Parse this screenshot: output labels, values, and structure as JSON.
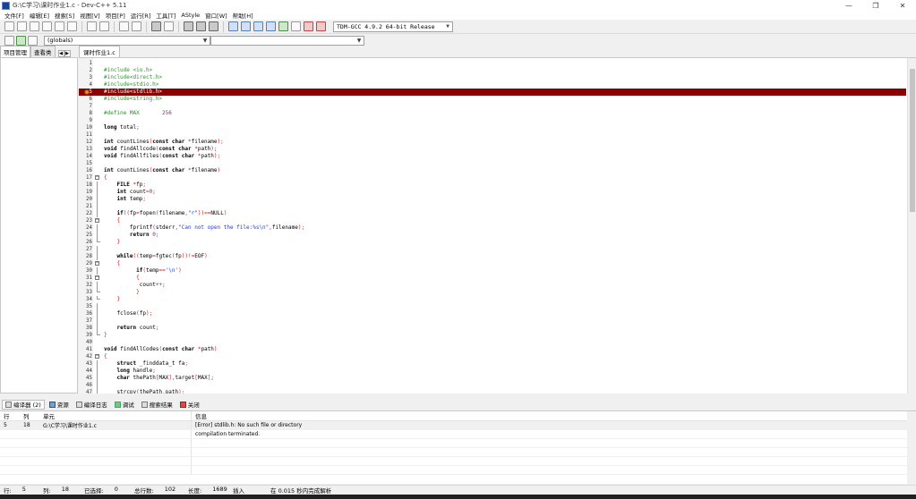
{
  "window": {
    "title": "G:\\C学习\\课时作业1.c - Dev-C++ 5.11",
    "minimize": "—",
    "maximize": "❐",
    "close": "✕"
  },
  "menu": [
    "文件[F]",
    "编辑[E]",
    "搜索[S]",
    "视图[V]",
    "项目[P]",
    "运行[R]",
    "工具[T]",
    "AStyle",
    "窗口[W]",
    "帮助[H]"
  ],
  "toolbar": {
    "compiler": "TDM-GCC 4.9.2 64-bit Release",
    "scope": "(globals)",
    "function": ""
  },
  "left_panel": {
    "tabs": [
      "项目管理",
      "查看类"
    ]
  },
  "editor": {
    "tab": "课时作业1.c",
    "error_line": 5
  },
  "code": [
    {
      "n": "1",
      "t": ""
    },
    {
      "n": "2",
      "t": "#include <io.h>"
    },
    {
      "n": "3",
      "t": "#include<direct.h>"
    },
    {
      "n": "4",
      "t": "#include<stdio.h>"
    },
    {
      "n": "5",
      "t": "#include<stdlib.h>"
    },
    {
      "n": "6",
      "t": "#include<string.h>"
    },
    {
      "n": "7",
      "t": ""
    },
    {
      "n": "8",
      "t": "#define MAX       256"
    },
    {
      "n": "9",
      "t": ""
    },
    {
      "n": "10",
      "t": "long total;"
    },
    {
      "n": "11",
      "t": ""
    },
    {
      "n": "12",
      "t": "int countLines(const char *filename);"
    },
    {
      "n": "13",
      "t": "void findAllcode(const char *path);"
    },
    {
      "n": "14",
      "t": "void findAllfiles(const char *path);"
    },
    {
      "n": "15",
      "t": ""
    },
    {
      "n": "16",
      "t": "int countLines(const char *filename)"
    },
    {
      "n": "17",
      "t": "{"
    },
    {
      "n": "18",
      "t": "    FILE *fp;"
    },
    {
      "n": "19",
      "t": "    int count=0;"
    },
    {
      "n": "20",
      "t": "    int temp;"
    },
    {
      "n": "21",
      "t": ""
    },
    {
      "n": "22",
      "t": "    if((fp=fopen(filename,\"r\"))==NULL)"
    },
    {
      "n": "23",
      "t": "    {"
    },
    {
      "n": "24",
      "t": "        fprintf(stderr,\"Can not open the file:%s\\n\",filename);"
    },
    {
      "n": "25",
      "t": "        return 0;"
    },
    {
      "n": "26",
      "t": "    }"
    },
    {
      "n": "27",
      "t": ""
    },
    {
      "n": "28",
      "t": "    while((temp=fgtec(fp))!=EOF)"
    },
    {
      "n": "29",
      "t": "    {"
    },
    {
      "n": "30",
      "t": "          if(temp=='\\n')"
    },
    {
      "n": "31",
      "t": "          {"
    },
    {
      "n": "32",
      "t": "           count++;"
    },
    {
      "n": "33",
      "t": "          }"
    },
    {
      "n": "34",
      "t": "    }"
    },
    {
      "n": "35",
      "t": ""
    },
    {
      "n": "36",
      "t": "    fclose(fp);"
    },
    {
      "n": "37",
      "t": ""
    },
    {
      "n": "38",
      "t": "    return count;"
    },
    {
      "n": "39",
      "t": "}"
    },
    {
      "n": "40",
      "t": ""
    },
    {
      "n": "41",
      "t": "void findAllCodes(const char *path)"
    },
    {
      "n": "42",
      "t": "{"
    },
    {
      "n": "43",
      "t": "    struct _finddata_t fa;"
    },
    {
      "n": "44",
      "t": "    long handle;"
    },
    {
      "n": "45",
      "t": "    char thePath[MAX],target[MAX];"
    },
    {
      "n": "46",
      "t": ""
    },
    {
      "n": "47",
      "t": "    strcpy(thePath,path);"
    }
  ],
  "bottom_tabs": [
    "编译器 (2)",
    "资源",
    "编译日志",
    "调试",
    "搜索结果",
    "关闭"
  ],
  "messages": {
    "headers": {
      "line": "行",
      "col": "列",
      "unit": "单元",
      "info": "信息"
    },
    "rows": [
      {
        "line": "5",
        "col": "18",
        "unit": "G:\\C学习\\课时作业1.c",
        "info": "[Error] stdlib.h: No such file or directory"
      },
      {
        "line": "",
        "col": "",
        "unit": "",
        "info": "compilation terminated."
      }
    ]
  },
  "status": {
    "row_label": "行:",
    "row": "5",
    "col_label": "列:",
    "col": "18",
    "sel_label": "已选择:",
    "sel": "0",
    "total_label": "总行数:",
    "total": "102",
    "len_label": "长度:",
    "len": "1689",
    "mode": "插入",
    "parse": "在 0.015 秒内完成解析"
  }
}
